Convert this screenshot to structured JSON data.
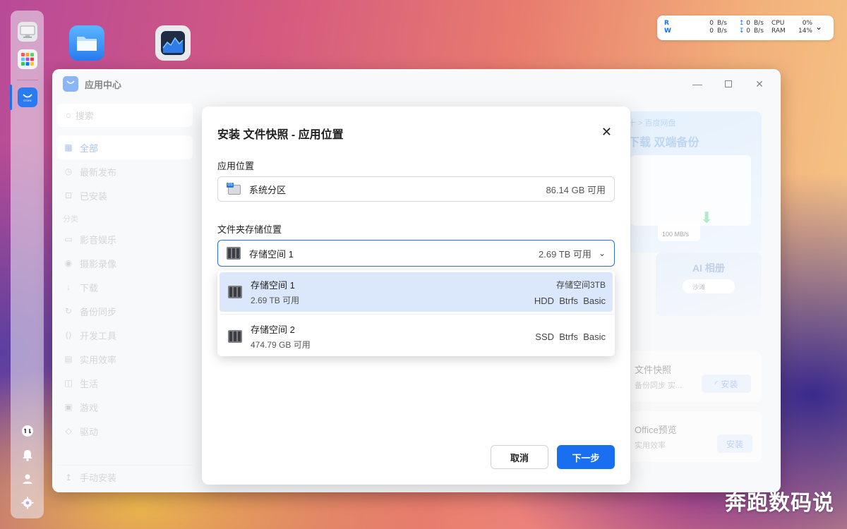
{
  "dock": {
    "apps": [
      "monitor-icon",
      "apps-grid-icon",
      "app-store-icon"
    ],
    "bottom": [
      "sync-icon",
      "bell-icon",
      "user-icon",
      "gear-icon"
    ]
  },
  "netwidget": {
    "r_label": "R",
    "w_label": "W",
    "r_val": "0",
    "w_val": "0",
    "unit": "B/s",
    "up_val": "0",
    "down_val": "0",
    "cpu_label": "CPU",
    "cpu_val": "0%",
    "ram_label": "RAM",
    "ram_val": "14%"
  },
  "window": {
    "title": "应用中心",
    "logo_text": "STORE"
  },
  "sidebar": {
    "search_placeholder": "搜索",
    "items": [
      {
        "label": "全部",
        "icon": "grid-icon",
        "active": true
      },
      {
        "label": "最新发布",
        "icon": "clock-icon"
      },
      {
        "label": "已安装",
        "icon": "download-box-icon"
      }
    ],
    "section": "分类",
    "categories": [
      {
        "label": "影音娱乐",
        "icon": "video-icon"
      },
      {
        "label": "摄影录像",
        "icon": "camera-icon"
      },
      {
        "label": "下载",
        "icon": "download-icon"
      },
      {
        "label": "备份同步",
        "icon": "sync-icon"
      },
      {
        "label": "开发工具",
        "icon": "code-icon"
      },
      {
        "label": "实用效率",
        "icon": "briefcase-icon"
      },
      {
        "label": "生活",
        "icon": "cup-icon"
      },
      {
        "label": "游戏",
        "icon": "gamepad-icon"
      },
      {
        "label": "驱动",
        "icon": "cube-icon"
      }
    ],
    "manual_install": "手动安装"
  },
  "background_content": {
    "banner_crumb": "十 > 百度网盘",
    "banner_title": "下载 双端备份",
    "banner_speed": "100 MB/s",
    "ai_album": "AI 相册",
    "ai_search": "沙滩",
    "app1_name": "文件快照",
    "app1_desc": "备份同步 实...",
    "app1_btn": "安装",
    "app2_name": "Office预览",
    "app2_desc": "实用效率",
    "app2_btn": "安装"
  },
  "dialog": {
    "title": "安装 文件快照 - 应用位置",
    "app_location_label": "应用位置",
    "app_location": {
      "name": "系统分区",
      "free": "86.14 GB 可用",
      "badge": "OS"
    },
    "folder_label": "文件夹存储位置",
    "folder_selected": {
      "name": "存储空间 1",
      "free": "2.69 TB 可用"
    },
    "options": [
      {
        "name": "存储空间 1",
        "free": "2.69 TB 可用",
        "right_top": "存储空间3TB",
        "right_bottom": "HDD  Btrfs  Basic",
        "selected": true
      },
      {
        "name": "存储空间 2",
        "free": "474.79 GB 可用",
        "right_top": "",
        "right_bottom": "SSD  Btrfs  Basic",
        "selected": false
      }
    ],
    "cancel": "取消",
    "next": "下一步"
  },
  "watermark": "奔跑数码说",
  "colors": {
    "accent": "#1a6ff0",
    "selected_bg": "#dbe7fb"
  }
}
